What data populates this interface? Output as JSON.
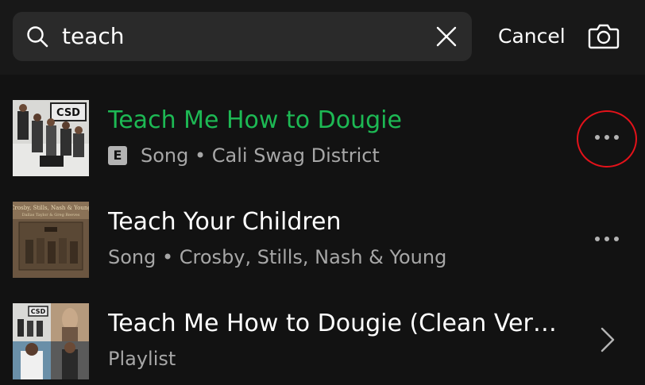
{
  "search": {
    "query": "teach",
    "cancel_label": "Cancel"
  },
  "results": [
    {
      "title": "Teach Me How to Dougie",
      "explicit_badge": "E",
      "subtitle": "Song • Cali Swag District",
      "title_color": "#1db954",
      "action": "more"
    },
    {
      "title": "Teach Your Children",
      "subtitle": "Song • Crosby, Stills, Nash & Young",
      "action": "more"
    },
    {
      "title": "Teach Me How to Dougie (Clean Versi...",
      "subtitle": "Playlist",
      "action": "chevron"
    }
  ],
  "colors": {
    "accent": "#1db954",
    "highlight_ring": "#e4121a",
    "background": "#121212",
    "secondary_text": "#a7a7a7"
  }
}
